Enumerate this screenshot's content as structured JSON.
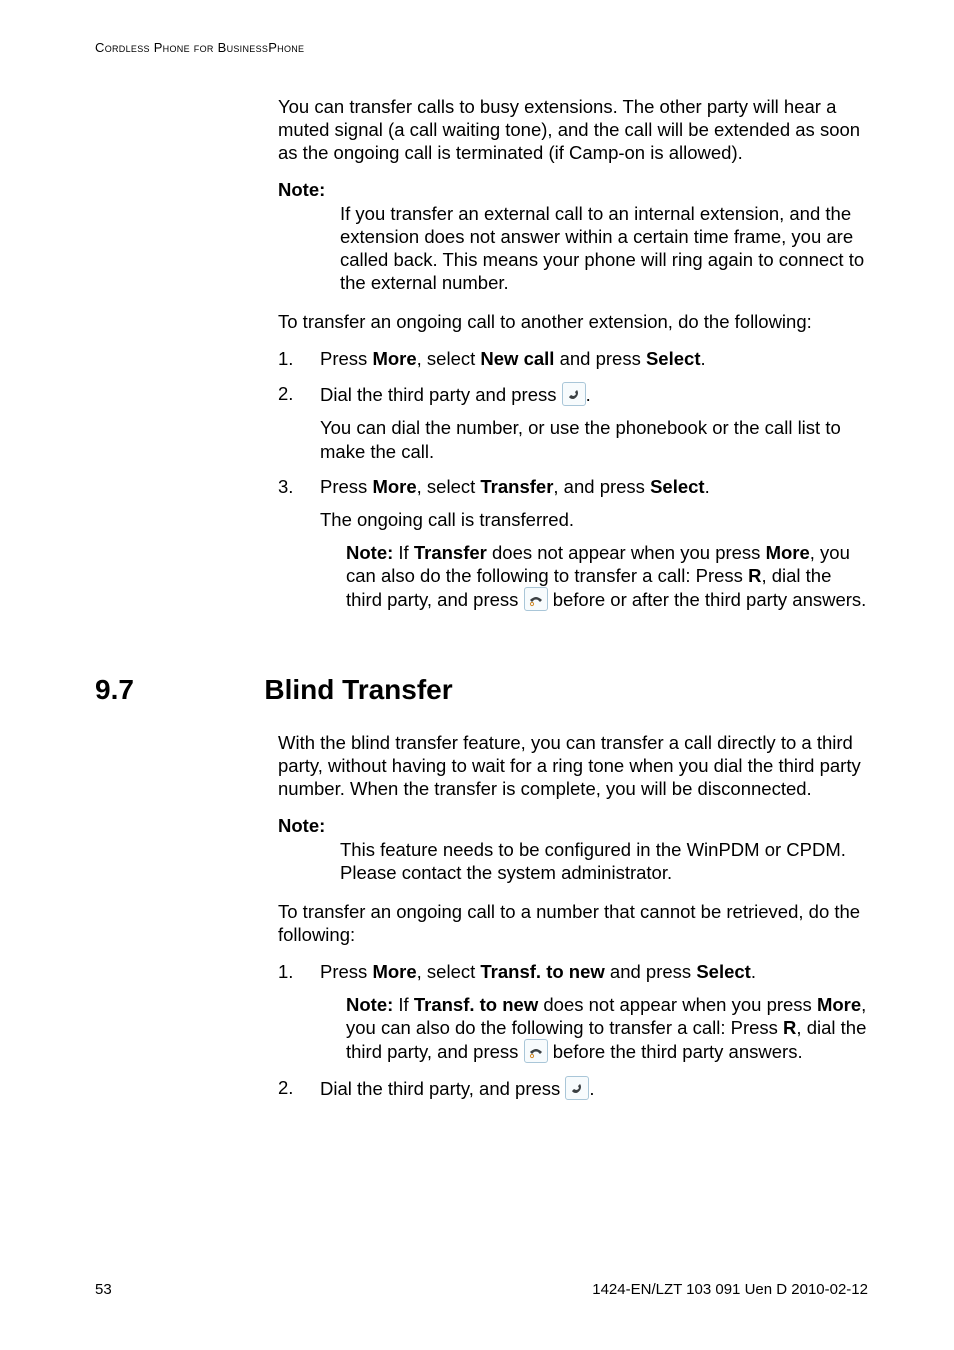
{
  "running_head": "Cordless Phone for BusinessPhone",
  "intro1": "You can transfer calls to busy extensions. The other party will hear a muted signal (a call waiting tone), and the call will be extended as soon as the ongoing call is terminated (if Camp-on is allowed).",
  "note1_lead": "Note:",
  "note1_body": "If you transfer an external call to an internal extension, and the extension does not answer within a certain time frame, you are called back. This means your phone will ring again to connect to the external number.",
  "lead1": "To transfer an ongoing call to another extension, do the following:",
  "steps1": {
    "s1": {
      "num": "1.",
      "t1": "Press ",
      "b1": "More",
      "t2": ", select ",
      "b2": "New call",
      "t3": " and press ",
      "b3": "Select",
      "t4": "."
    },
    "s2": {
      "num": "2.",
      "t1": "Dial the third party and press ",
      "t2": ".",
      "sub": "You can dial the number, or use the phonebook or the call list to make the call."
    },
    "s3": {
      "num": "3.",
      "t1": "Press ",
      "b1": "More",
      "t2": ", select ",
      "b2": "Transfer",
      "t3": ", and press ",
      "b3": "Select",
      "t4": ".",
      "sub": "The ongoing call is transferred.",
      "note_lead": "Note:",
      "note_t1": "If ",
      "note_b1": "Transfer",
      "note_t2": " does not appear when you press ",
      "note_b2": "More",
      "note_t3": ", you can also do the following to transfer a call: Press ",
      "note_b3": "R",
      "note_t4": ", dial the third party, and press ",
      "note_t5": " before or after the third party answers."
    }
  },
  "section": {
    "number": "9.7",
    "title": "Blind Transfer"
  },
  "intro2": "With the blind transfer feature, you can transfer a call directly to a third party, without having to wait for a ring tone when you dial the third party number. When the transfer is complete, you will be disconnected.",
  "note2_lead": "Note:",
  "note2_body": "This feature needs to be configured in the WinPDM or CPDM. Please contact the system administrator.",
  "lead2": "To transfer an ongoing call to a number that cannot be retrieved, do the following:",
  "steps2": {
    "s1": {
      "num": "1.",
      "t1": "Press ",
      "b1": "More",
      "t2": ", select ",
      "b2": "Transf. to new",
      "t3": " and press ",
      "b3": "Select",
      "t4": ".",
      "note_lead": "Note:",
      "note_t1": "If ",
      "note_b1": "Transf. to new",
      "note_t2": " does not appear when you press ",
      "note_b2": "More",
      "note_t3": ", you can also do the following to transfer a call: Press ",
      "note_b3": "R",
      "note_t4": ", dial the third party, and press ",
      "note_t5": " before the third party answers."
    },
    "s2": {
      "num": "2.",
      "t1": "Dial the third party, and press ",
      "t2": "."
    }
  },
  "footer": {
    "page": "53",
    "docid": "1424-EN/LZT 103 091 Uen D 2010-02-12"
  }
}
